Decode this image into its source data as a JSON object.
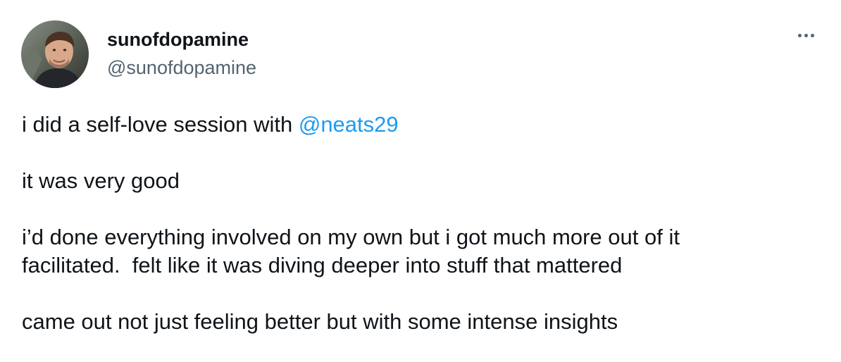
{
  "tweet": {
    "author": {
      "display_name": "sunofdopamine",
      "handle": "@sunofdopamine"
    },
    "more_icon": "more-horizontal-icon",
    "paragraphs": {
      "p1_prefix": "i did a self-love session with ",
      "p1_mention": "@neats29",
      "p2": "it was very good",
      "p3_line1": "i’d done everything involved on my own but i got much more out of it",
      "p3_line2": "facilitated.  felt like it was diving deeper into stuff that mattered",
      "p4": "came out not just feeling better but with some intense insights"
    },
    "colors": {
      "text": "#0f1419",
      "secondary": "#536471",
      "link": "#1d9bf0"
    }
  }
}
